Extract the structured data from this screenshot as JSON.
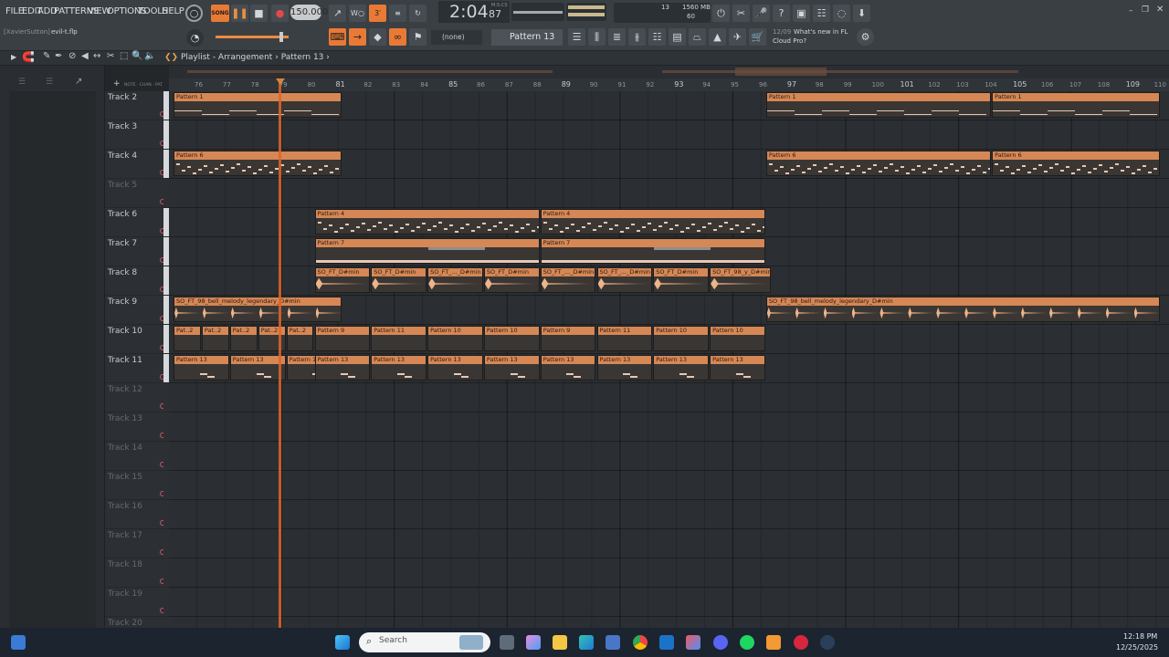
{
  "menu": [
    "FILE",
    "EDIT",
    "ADD",
    "PATTERNS",
    "VIEW",
    "OPTIONS",
    "TOOLS",
    "HELP"
  ],
  "transport": {
    "mode": "SONG",
    "tempo": "150.000",
    "time": "2:04",
    "time_sub": "87",
    "time_unit": "M:S:CS",
    "cpu_voices": "13",
    "memory": "1560 MB",
    "memory_sub": "60"
  },
  "user": "[XavierSutton]",
  "file_name": "evil-t.flp",
  "hint": {
    "label": "(none)"
  },
  "pattern_selector": "Pattern 13",
  "news": {
    "date": "12/09",
    "text1": "What's new in FL",
    "text2": "Cloud Pro?"
  },
  "breadcrumb": {
    "title": "Playlist - Arrangement",
    "pattern": "Pattern 13"
  },
  "ruler_ticks": [
    {
      "l": "76",
      "major": false
    },
    {
      "l": "77",
      "major": false
    },
    {
      "l": "78",
      "major": false
    },
    {
      "l": "79",
      "major": false
    },
    {
      "l": "80",
      "major": false
    },
    {
      "l": "81",
      "major": true
    },
    {
      "l": "82",
      "major": false
    },
    {
      "l": "83",
      "major": false
    },
    {
      "l": "84",
      "major": false
    },
    {
      "l": "85",
      "major": true
    },
    {
      "l": "86",
      "major": false
    },
    {
      "l": "87",
      "major": false
    },
    {
      "l": "88",
      "major": false
    },
    {
      "l": "89",
      "major": true
    },
    {
      "l": "90",
      "major": false
    },
    {
      "l": "91",
      "major": false
    },
    {
      "l": "92",
      "major": false
    },
    {
      "l": "93",
      "major": true
    },
    {
      "l": "94",
      "major": false
    },
    {
      "l": "95",
      "major": false
    },
    {
      "l": "96",
      "major": false
    },
    {
      "l": "97",
      "major": true
    },
    {
      "l": "98",
      "major": false
    },
    {
      "l": "99",
      "major": false
    },
    {
      "l": "100",
      "major": false
    },
    {
      "l": "101",
      "major": true
    },
    {
      "l": "102",
      "major": false
    },
    {
      "l": "103",
      "major": false
    },
    {
      "l": "104",
      "major": false
    },
    {
      "l": "105",
      "major": true
    },
    {
      "l": "106",
      "major": false
    },
    {
      "l": "107",
      "major": false
    },
    {
      "l": "108",
      "major": false
    },
    {
      "l": "109",
      "major": true
    },
    {
      "l": "110",
      "major": false
    }
  ],
  "tracks": [
    {
      "name": "Track 2",
      "active": true,
      "clips": [
        {
          "b": 76,
          "l": 6,
          "t": "Pattern 1",
          "k": "line"
        },
        {
          "b": 97,
          "l": 8,
          "t": "Pattern 1",
          "k": "line"
        },
        {
          "b": 105,
          "l": 6,
          "t": "Pattern 1",
          "k": "line"
        }
      ]
    },
    {
      "name": "Track 3",
      "active": true,
      "clips": []
    },
    {
      "name": "Track 4",
      "active": true,
      "clips": [
        {
          "b": 76,
          "l": 6,
          "t": "Pattern 6",
          "k": "notes"
        },
        {
          "b": 97,
          "l": 8,
          "t": "Pattern 6",
          "k": "notes"
        },
        {
          "b": 105,
          "l": 6,
          "t": "Pattern 6",
          "k": "notes"
        }
      ]
    },
    {
      "name": "Track 5",
      "active": false,
      "clips": []
    },
    {
      "name": "Track 6",
      "active": true,
      "clips": [
        {
          "b": 81,
          "l": 8,
          "t": "Pattern 4",
          "k": "notes"
        },
        {
          "b": 89,
          "l": 8,
          "t": "Pattern 4",
          "k": "notes"
        }
      ]
    },
    {
      "name": "Track 7",
      "active": true,
      "clips": [
        {
          "b": 81,
          "l": 8,
          "t": "Pattern 7",
          "k": "bars"
        },
        {
          "b": 89,
          "l": 8,
          "t": "Pattern 7",
          "k": "bars"
        }
      ]
    },
    {
      "name": "Track 8",
      "active": true,
      "clips": [
        {
          "b": 81,
          "l": 2,
          "t": "SO_FT_D#min",
          "k": "wave"
        },
        {
          "b": 83,
          "l": 2,
          "t": "SO_FT_D#min",
          "k": "wave"
        },
        {
          "b": 85,
          "l": 2,
          "t": "SO_FT_..._D#min",
          "k": "wave"
        },
        {
          "b": 87,
          "l": 2,
          "t": "SO_FT_D#min",
          "k": "wave"
        },
        {
          "b": 89,
          "l": 2,
          "t": "SO_FT_..._D#min",
          "k": "wave"
        },
        {
          "b": 91,
          "l": 2,
          "t": "SO_FT_..._D#min",
          "k": "wave"
        },
        {
          "b": 93,
          "l": 2,
          "t": "SO_FT_D#min",
          "k": "wave"
        },
        {
          "b": 95,
          "l": 2.2,
          "t": "SO_FT_98_y_D#min",
          "k": "wave"
        }
      ]
    },
    {
      "name": "Track 9",
      "active": true,
      "clips": [
        {
          "b": 76,
          "l": 6,
          "t": "SO_FT_98_bell_melody_legendary_D#min",
          "k": "bell"
        },
        {
          "b": 97,
          "l": 14,
          "t": "SO_FT_98_bell_melody_legendary_D#min",
          "k": "bell"
        }
      ]
    },
    {
      "name": "Track 10",
      "active": true,
      "clips": [
        {
          "b": 76,
          "l": 1,
          "t": "Pat..2",
          "k": "blank"
        },
        {
          "b": 77,
          "l": 1,
          "t": "Pat..2",
          "k": "blank"
        },
        {
          "b": 78,
          "l": 1,
          "t": "Pat..2",
          "k": "blank"
        },
        {
          "b": 79,
          "l": 1,
          "t": "Pat..2",
          "k": "blank"
        },
        {
          "b": 80,
          "l": 1,
          "t": "Pat..2",
          "k": "blank"
        },
        {
          "b": 81,
          "l": 2,
          "t": "Pattern 9",
          "k": "blank"
        },
        {
          "b": 83,
          "l": 2,
          "t": "Pattern 11",
          "k": "blank"
        },
        {
          "b": 85,
          "l": 2,
          "t": "Pattern 10",
          "k": "blank"
        },
        {
          "b": 87,
          "l": 2,
          "t": "Pattern 10",
          "k": "blank"
        },
        {
          "b": 89,
          "l": 2,
          "t": "Pattern 9",
          "k": "blank"
        },
        {
          "b": 91,
          "l": 2,
          "t": "Pattern 11",
          "k": "blank"
        },
        {
          "b": 93,
          "l": 2,
          "t": "Pattern 10",
          "k": "blank"
        },
        {
          "b": 95,
          "l": 2,
          "t": "Pattern 10",
          "k": "blank"
        }
      ]
    },
    {
      "name": "Track 11",
      "active": true,
      "clips": [
        {
          "b": 76,
          "l": 2,
          "t": "Pattern 13",
          "k": "dash"
        },
        {
          "b": 78,
          "l": 2,
          "t": "Pattern 13",
          "k": "dash"
        },
        {
          "b": 80,
          "l": 2,
          "t": "Pattern 13",
          "k": "dash"
        },
        {
          "b": 81,
          "l": 2,
          "t": "Pattern 13",
          "k": "dash"
        },
        {
          "b": 83,
          "l": 2,
          "t": "Pattern 13",
          "k": "dash"
        },
        {
          "b": 85,
          "l": 2,
          "t": "Pattern 13",
          "k": "dash"
        },
        {
          "b": 87,
          "l": 2,
          "t": "Pattern 13",
          "k": "dash"
        },
        {
          "b": 89,
          "l": 2,
          "t": "Pattern 13",
          "k": "dash"
        },
        {
          "b": 91,
          "l": 2,
          "t": "Pattern 13",
          "k": "dash"
        },
        {
          "b": 93,
          "l": 2,
          "t": "Pattern 13",
          "k": "dash"
        },
        {
          "b": 95,
          "l": 2,
          "t": "Pattern 13",
          "k": "dash"
        }
      ]
    },
    {
      "name": "Track 12",
      "active": false,
      "clips": []
    },
    {
      "name": "Track 13",
      "active": false,
      "clips": []
    },
    {
      "name": "Track 14",
      "active": false,
      "clips": []
    },
    {
      "name": "Track 15",
      "active": false,
      "clips": []
    },
    {
      "name": "Track 16",
      "active": false,
      "clips": []
    },
    {
      "name": "Track 17",
      "active": false,
      "clips": []
    },
    {
      "name": "Track 18",
      "active": false,
      "clips": []
    },
    {
      "name": "Track 19",
      "active": false,
      "clips": []
    },
    {
      "name": "Track 20",
      "active": false,
      "clips": []
    }
  ],
  "taskbar": {
    "search_placeholder": "Search",
    "time": "12:18 PM",
    "date": "12/25/2025"
  },
  "colors": {
    "clip_header": "#d58755",
    "playhead": "#e0652a",
    "accent": "#e87a35"
  }
}
